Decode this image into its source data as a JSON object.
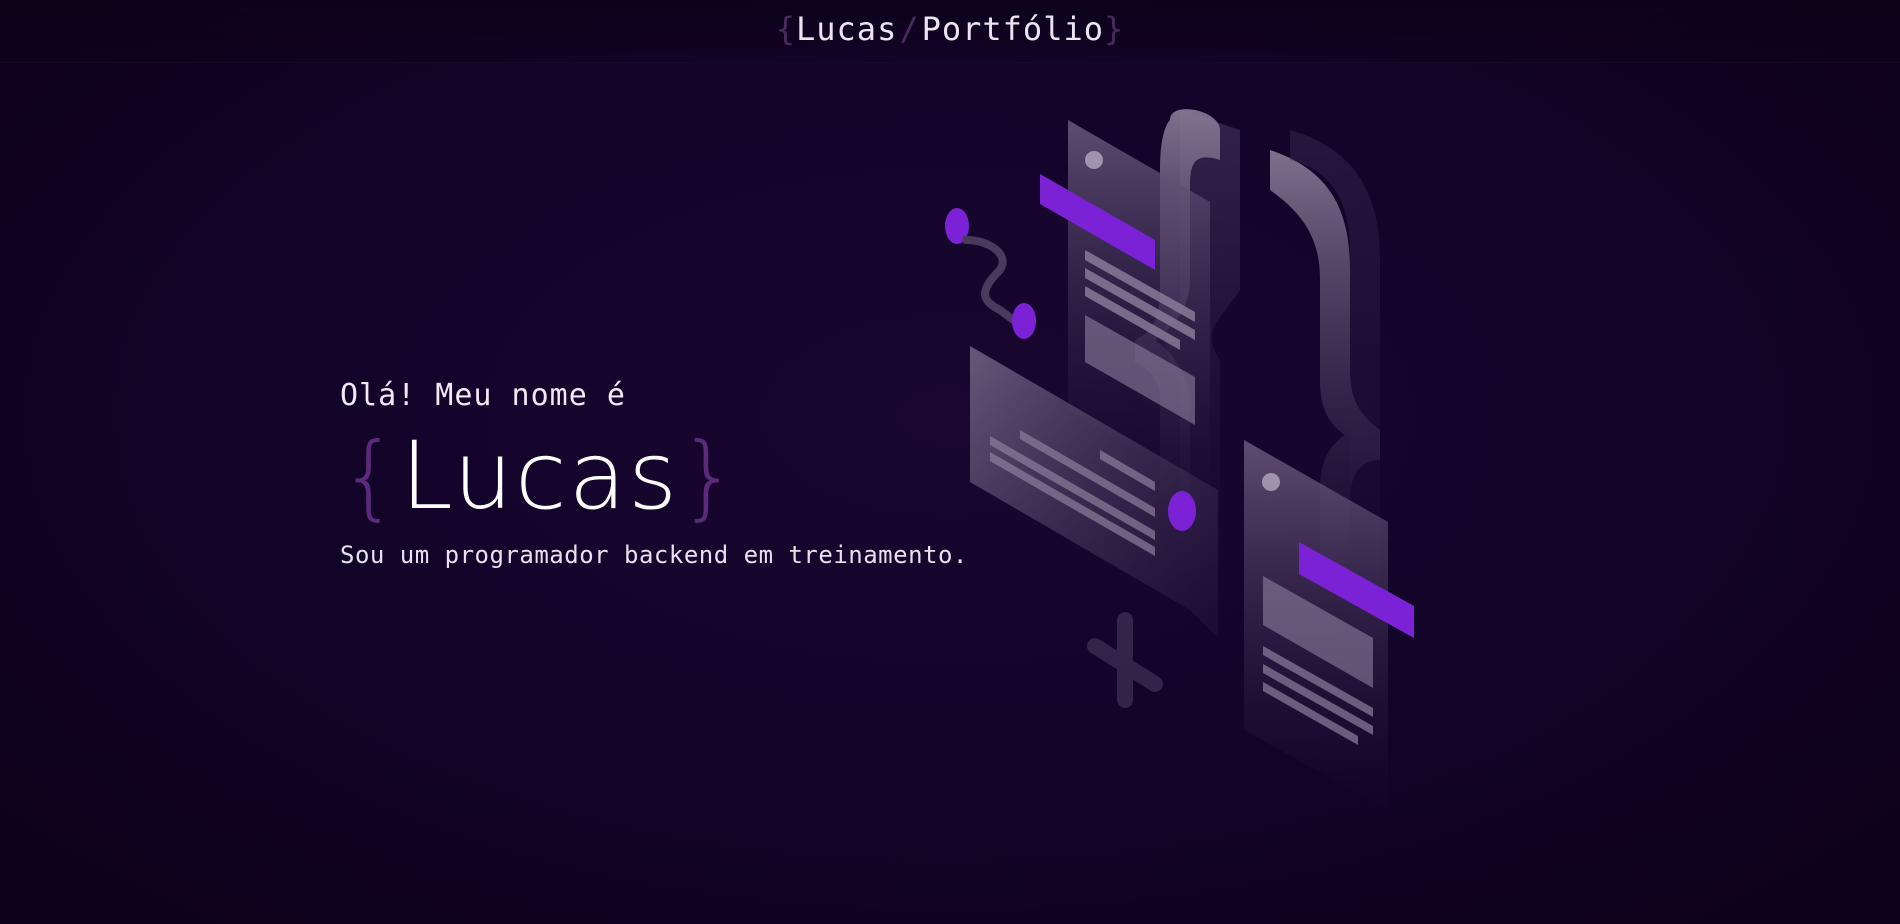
{
  "header": {
    "logo_open_brace": "{",
    "logo_first": "Lucas",
    "logo_slash": "/",
    "logo_second": "Portfólio",
    "logo_close_brace": "}"
  },
  "hero": {
    "greeting": "Olá! Meu nome é",
    "name_open_brace": "{",
    "name": "Lucas",
    "name_close_brace": "}",
    "subtitle": "Sou um programador backend em treinamento."
  },
  "colors": {
    "background": "#13042a",
    "accent": "#7b22d6",
    "brace": "#5b2a7a",
    "panel": "#5b4a6e"
  }
}
